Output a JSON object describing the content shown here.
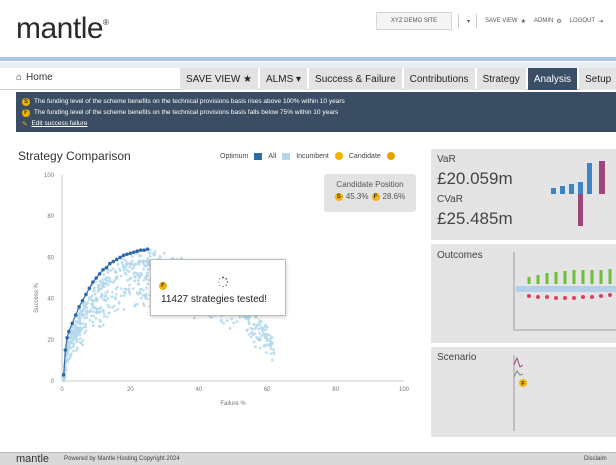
{
  "header": {
    "logo": "mantle",
    "logo_mark": "®",
    "site": "XYZ DEMO SITE",
    "save_view": "SAVE VIEW",
    "admin": "ADMIN",
    "logout": "LOGOUT"
  },
  "nav": {
    "home": "Home",
    "tabs": [
      {
        "label": "SAVE VIEW ★"
      },
      {
        "label": "ALMS ▾"
      },
      {
        "label": "Success & Failure"
      },
      {
        "label": "Contributions"
      },
      {
        "label": "Strategy"
      },
      {
        "label": "Analysis",
        "active": true
      },
      {
        "label": "Setup"
      }
    ]
  },
  "notice": {
    "success_badge": "S",
    "failure_badge": "F",
    "success_text": "The funding level of the scheme benefits on the technical provisions basis rises above 100% within 10 years",
    "failure_text": "The funding level of the scheme benefits on the technical provisions basis falls below 75% within 10 years",
    "edit_link": "Edit success failure"
  },
  "strategy": {
    "title": "Strategy Comparison",
    "legend": {
      "optimum": "Optimum",
      "all": "All",
      "incumbent": "Incumbent",
      "candidate": "Candidate"
    },
    "candidate_box": {
      "title": "Candidate Position",
      "s_badge": "S",
      "s_value": "45.3%",
      "f_badge": "F",
      "f_value": "28.6%"
    },
    "popup": {
      "badge": "F",
      "message": "11427 strategies tested!"
    }
  },
  "chart_data": {
    "type": "scatter",
    "xlabel": "Failure %",
    "ylabel": "Success %",
    "xlim": [
      0,
      100
    ],
    "ylim": [
      0,
      100
    ],
    "xticks": [
      0,
      20,
      40,
      60,
      80,
      100
    ],
    "yticks": [
      0,
      20,
      40,
      60,
      80,
      100
    ],
    "series": [
      {
        "name": "Optimum",
        "color": "#2f6aa8",
        "x": [
          0.5,
          1,
          1.5,
          2,
          3,
          4,
          5,
          6,
          7,
          8,
          9,
          10,
          11,
          12,
          13,
          14,
          15,
          16,
          17,
          18,
          19,
          20,
          21,
          22,
          23,
          24,
          25
        ],
        "y": [
          3,
          15,
          21,
          24,
          28,
          32,
          36,
          39,
          42,
          45,
          48,
          50,
          52,
          54,
          55,
          57,
          58,
          59,
          60,
          61,
          61.5,
          62,
          62.5,
          63,
          63.5,
          63.5,
          64
        ]
      },
      {
        "name": "All",
        "color": "#b4d8ec"
      }
    ],
    "markers": [
      {
        "name": "Incumbent",
        "color": "#f5b300"
      },
      {
        "name": "Candidate",
        "color": "#e3a400"
      }
    ],
    "all_cloud": {
      "x_range": [
        0,
        62
      ],
      "y_range": [
        0,
        64
      ],
      "count": 900
    }
  },
  "right_panels": {
    "var_label": "VaR",
    "var_value": "£20.059m",
    "cvar_label": "CVaR",
    "cvar_value": "£25.485m",
    "outcomes_label": "Outcomes",
    "scenario_label": "Scenario",
    "scenario_badge": "F"
  },
  "footer": {
    "logo": "mantle",
    "text": "Powered by Mantle Hosting   Copyright 2024",
    "right": "Disclaim"
  },
  "colors": {
    "accent": "#3a4e66",
    "optimum": "#2f6aa8",
    "all": "#b4d8ec",
    "badge": "#f5b300",
    "var_bar": "#3b86c6",
    "var_pink": "#a0457a",
    "outcome_green": "#6cbf3a",
    "outcome_red": "#e03d62"
  }
}
